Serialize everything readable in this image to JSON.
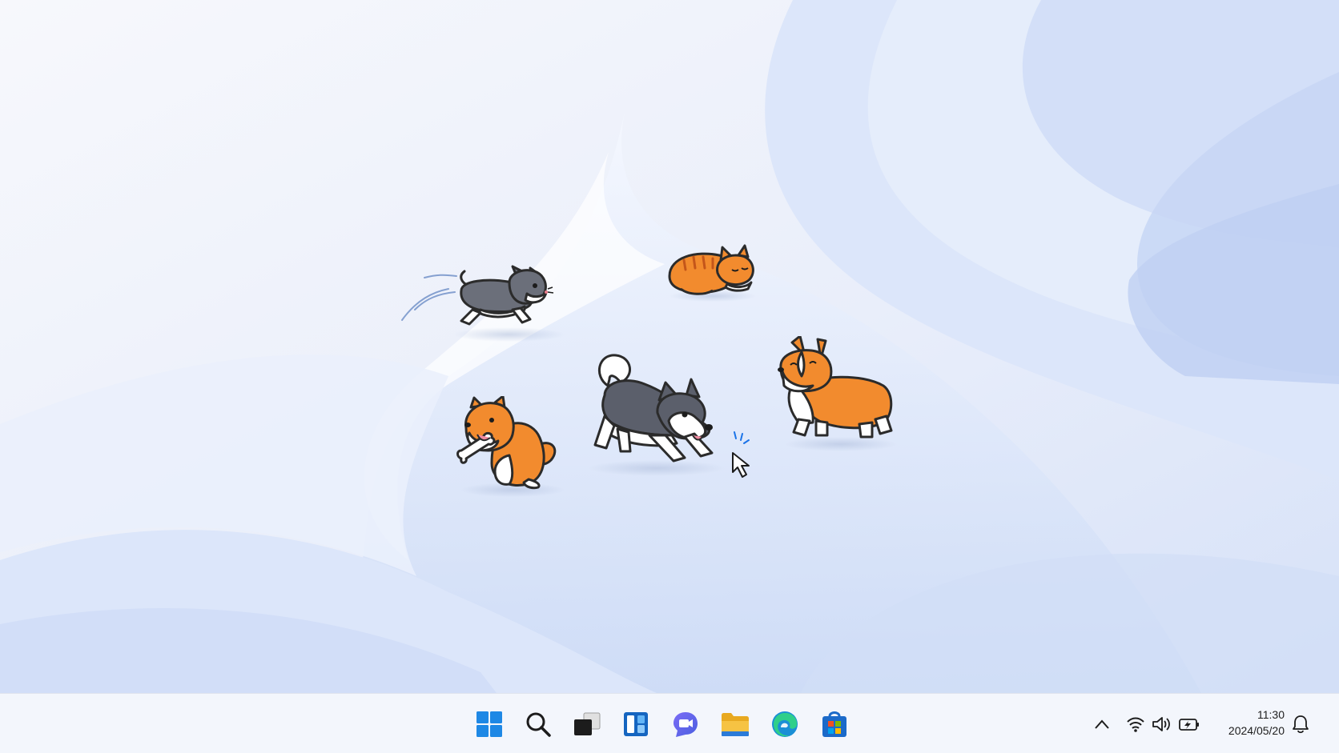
{
  "desktop": {
    "pets": [
      {
        "name": "gray-cat",
        "state": "running"
      },
      {
        "name": "orange-tabby-cat",
        "state": "sleeping"
      },
      {
        "name": "husky-dog",
        "state": "playing"
      },
      {
        "name": "shiba-dog",
        "state": "chewing-bone"
      },
      {
        "name": "corgi-dog",
        "state": "sitting"
      }
    ],
    "pointer": "mouse-pointer-icon"
  },
  "taskbar": {
    "apps": [
      {
        "name": "start-button",
        "icon": "windows-logo-icon"
      },
      {
        "name": "search-button",
        "icon": "search-icon"
      },
      {
        "name": "task-view-button",
        "icon": "task-view-icon"
      },
      {
        "name": "widgets-button",
        "icon": "widgets-icon"
      },
      {
        "name": "chat-button",
        "icon": "chat-icon"
      },
      {
        "name": "file-explorer-button",
        "icon": "folder-icon"
      },
      {
        "name": "edge-button",
        "icon": "edge-icon"
      },
      {
        "name": "store-button",
        "icon": "store-icon"
      }
    ],
    "tray": {
      "icons": [
        "chevron-up-icon",
        "wifi-icon",
        "volume-icon",
        "battery-icon",
        "bell-icon"
      ],
      "time": "11:30",
      "date": "2024/05/20"
    },
    "colors": {
      "accent": "#1a73e8",
      "folder": "#f6c343",
      "store": "#1b6ac9"
    }
  }
}
